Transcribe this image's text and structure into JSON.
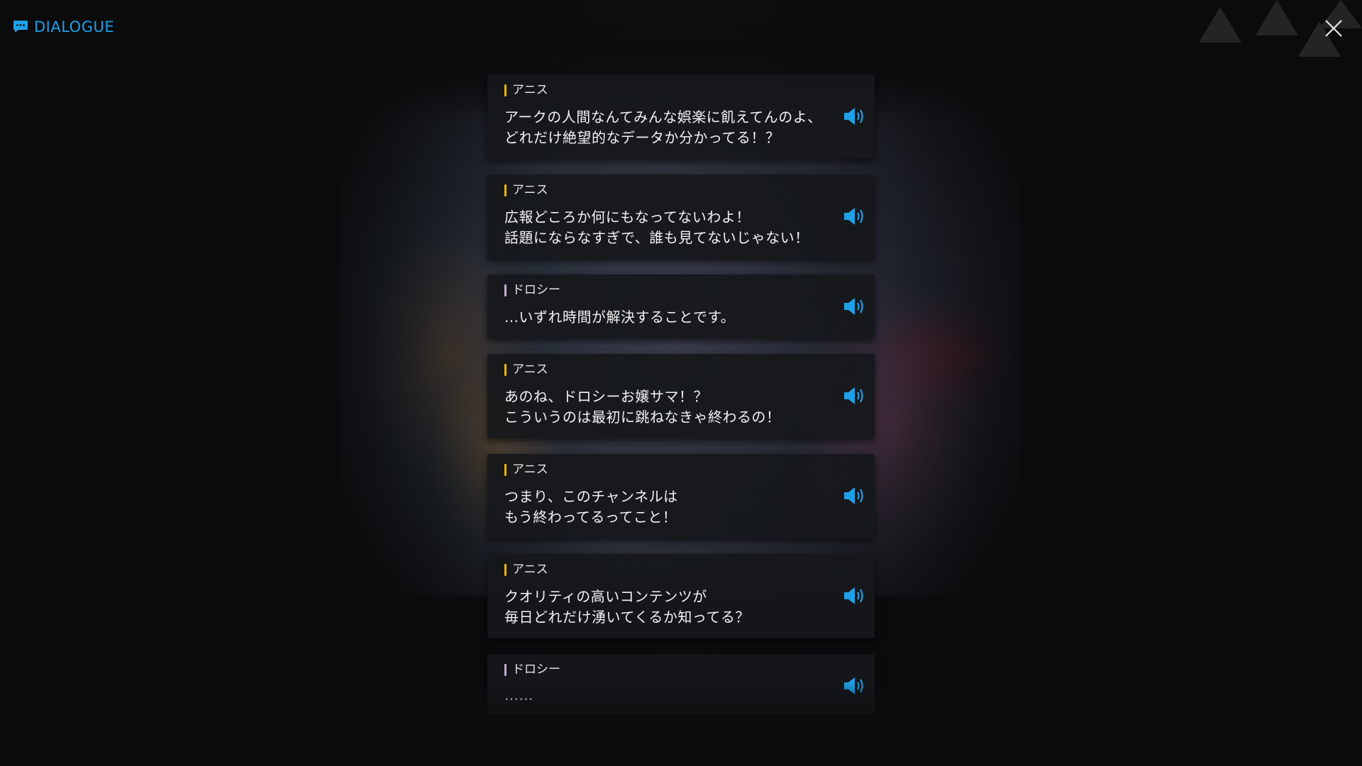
{
  "header": {
    "title": "DIALOGUE",
    "title_icon": "chat-bubble-icon",
    "close_icon": "close-icon"
  },
  "colors": {
    "accent": "#1ea0e8",
    "anis_marker": "#f0b400",
    "dorothy_marker": "#c8a8d8",
    "card_bg": "#16181b",
    "text": "#f2f2f2"
  },
  "dialogue": [
    {
      "speaker": "アニス",
      "marker": "anis",
      "lines": [
        "アークの人間なんてみんな娯楽に飢えてんのよ、",
        "どれだけ絶望的なデータか分かってる！？"
      ]
    },
    {
      "speaker": "アニス",
      "marker": "anis",
      "lines": [
        "広報どころか何にもなってないわよ！",
        "話題にならなすぎで、誰も見てないじゃない！"
      ]
    },
    {
      "speaker": "ドロシー",
      "marker": "dorothy",
      "lines": [
        "…いずれ時間が解決することです。"
      ]
    },
    {
      "speaker": "アニス",
      "marker": "anis",
      "lines": [
        "あのね、ドロシーお嬢サマ！？",
        "こういうのは最初に跳ねなきゃ終わるの！"
      ]
    },
    {
      "speaker": "アニス",
      "marker": "anis",
      "lines": [
        "つまり、このチャンネルは",
        "もう終わってるってこと！"
      ]
    },
    {
      "speaker": "アニス",
      "marker": "anis",
      "lines": [
        "クオリティの高いコンテンツが",
        "毎日どれだけ湧いてくるか知ってる？"
      ]
    },
    {
      "speaker": "ドロシー",
      "marker": "dorothy",
      "lines": [
        "……"
      ]
    }
  ],
  "voice_icon": "speaker-volume-icon"
}
